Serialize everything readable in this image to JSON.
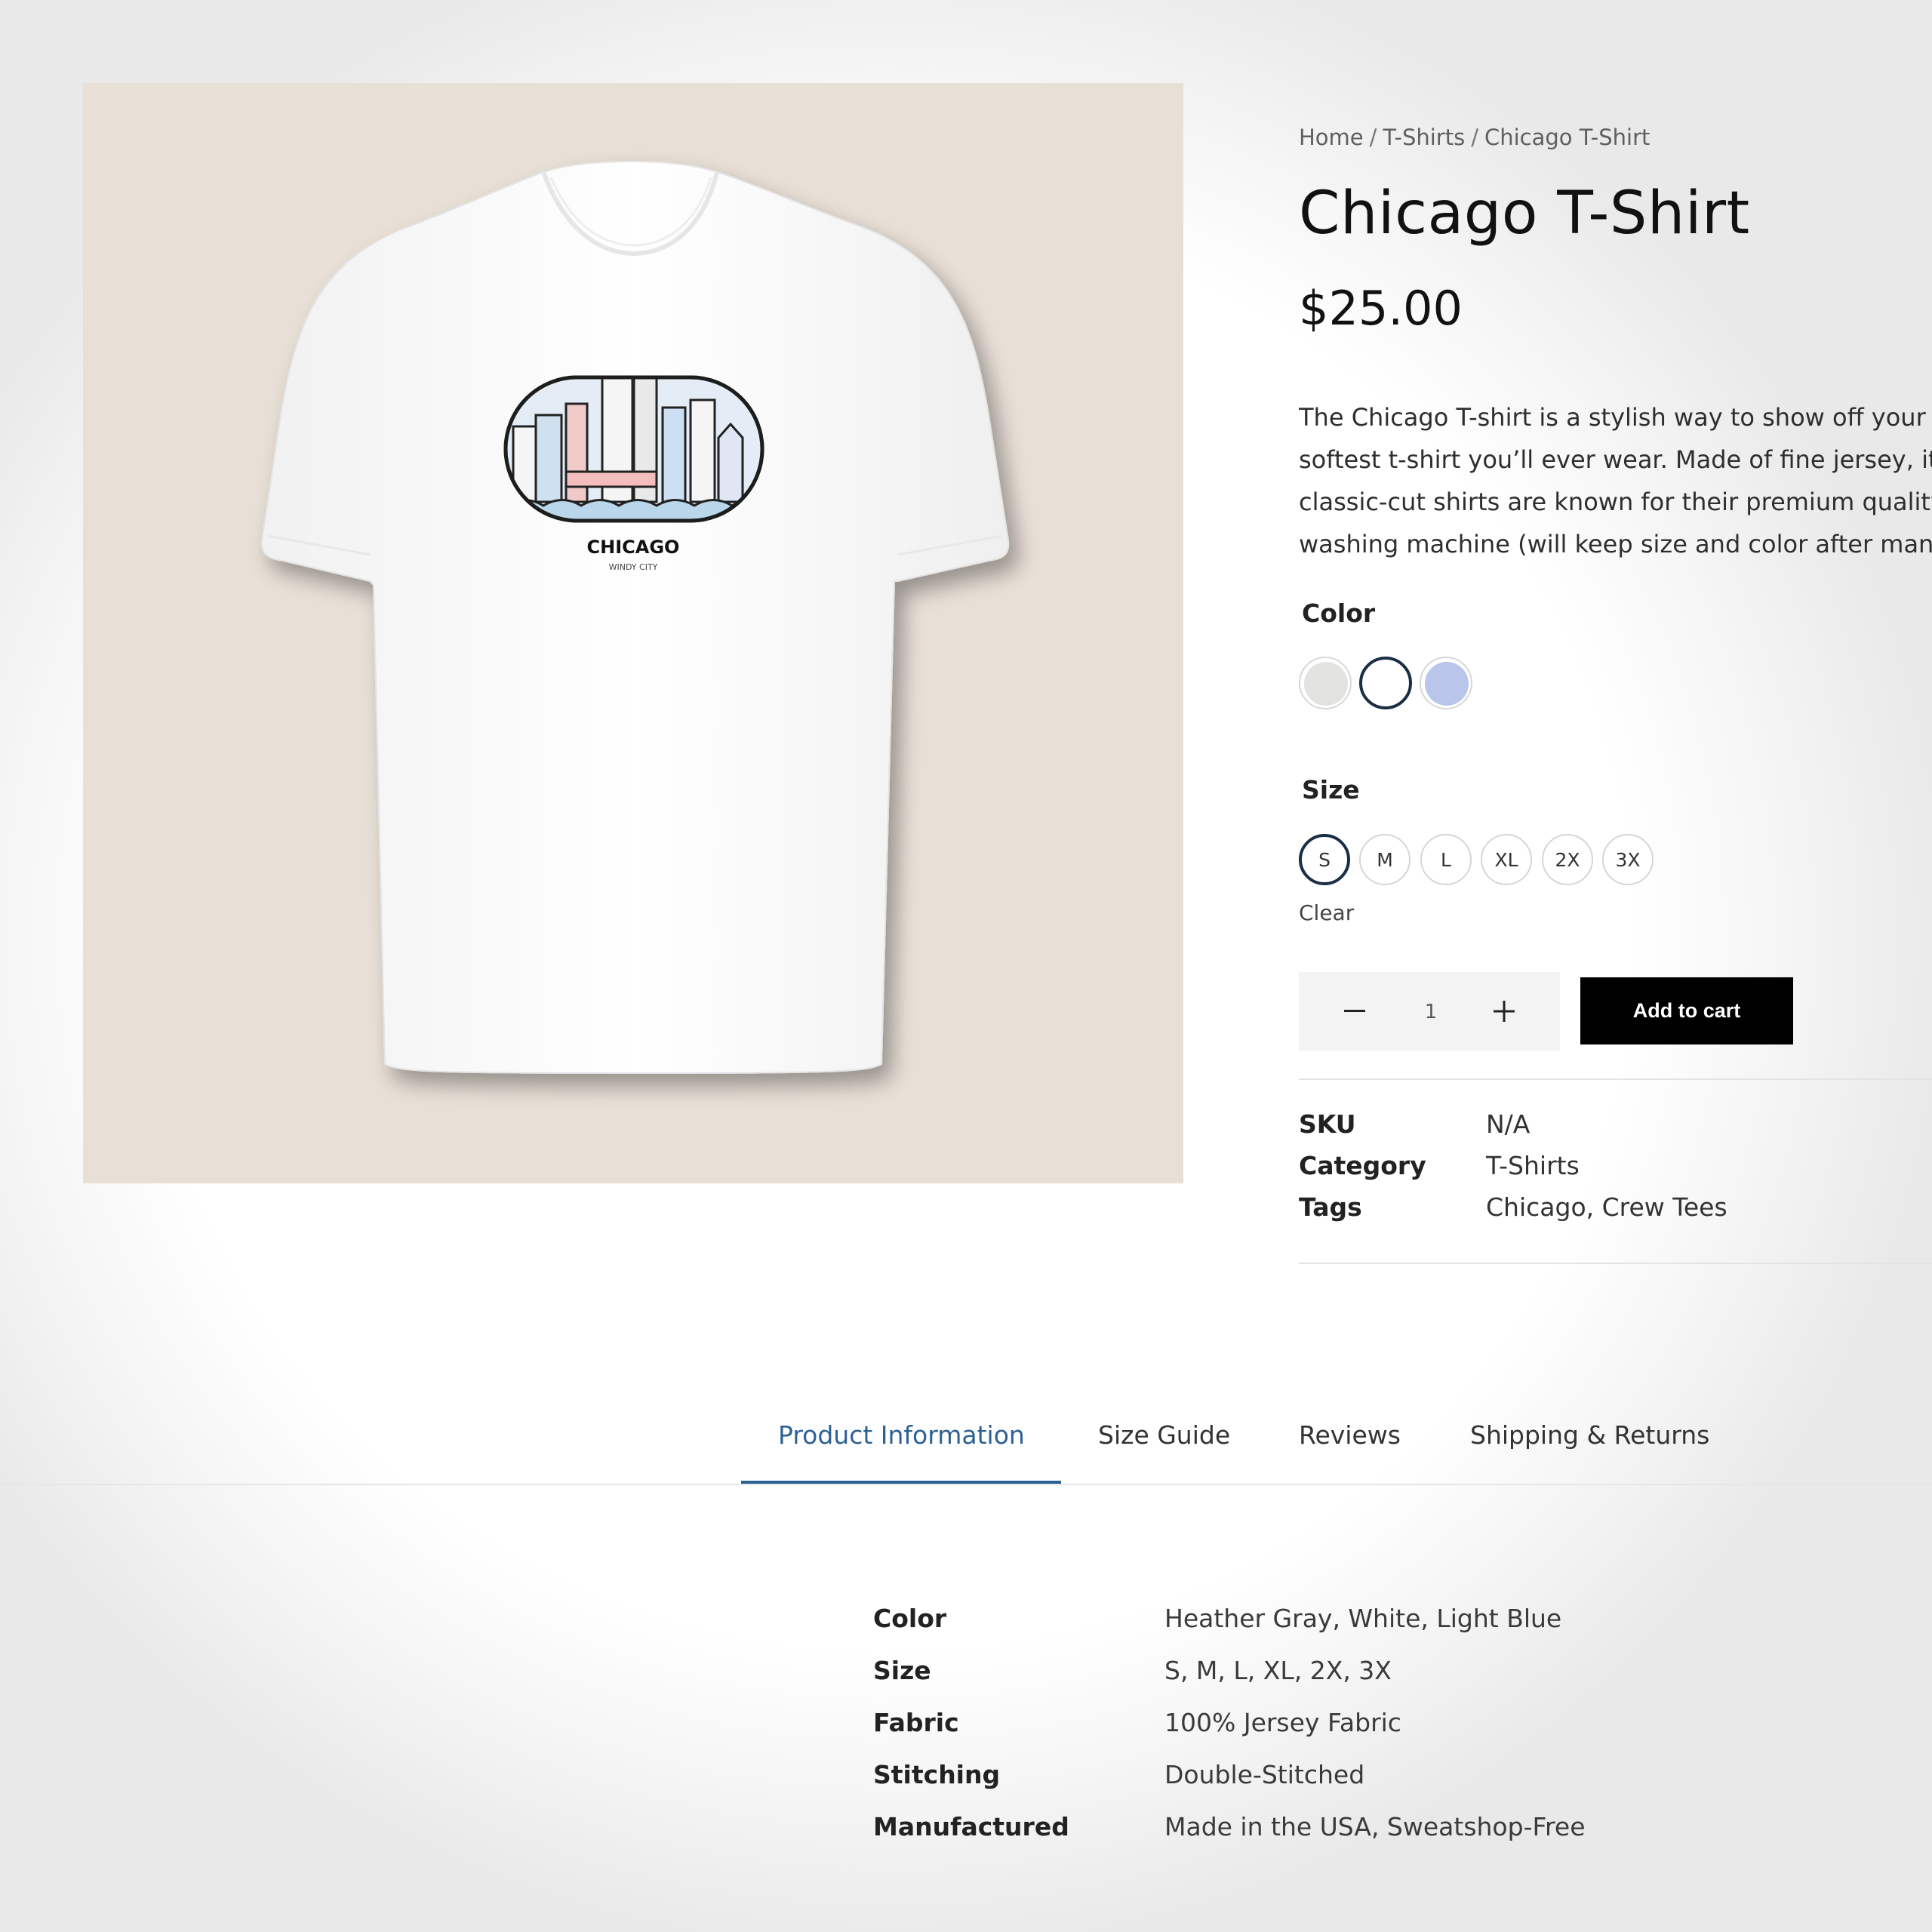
{
  "breadcrumb": {
    "home": "Home",
    "category": "T-Shirts",
    "current": "Chicago T-Shirt",
    "separator": "/"
  },
  "product": {
    "title": "Chicago T-Shirt",
    "price": "$25.00",
    "description_lines": [
      "The Chicago T-shirt is a stylish way to show off your c",
      "softest t-shirt you’ll ever wear. Made of fine jersey, it h",
      "classic-cut shirts are known for their premium quality",
      "washing machine (will keep size and color after many"
    ],
    "image": {
      "print_title": "CHICAGO",
      "print_subtitle": "WINDY CITY",
      "background_color": "#e8dfd6",
      "shirt_color": "#ffffff"
    }
  },
  "color_picker": {
    "label": "Color",
    "swatches": [
      {
        "name": "Heather Gray",
        "hex": "#e3e3e1",
        "selected": false
      },
      {
        "name": "White",
        "hex": "#ffffff",
        "selected": true
      },
      {
        "name": "Light Blue",
        "hex": "#b9c5ea",
        "selected": false
      }
    ]
  },
  "size_picker": {
    "label": "Size",
    "options": [
      "S",
      "M",
      "L",
      "XL",
      "2X",
      "3X"
    ],
    "selected": "S",
    "clear_label": "Clear"
  },
  "cart": {
    "quantity": "1",
    "minus_icon": "minus-icon",
    "plus_icon": "plus-icon",
    "add_label": "Add to cart"
  },
  "meta": {
    "sku_label": "SKU",
    "sku_value": "N/A",
    "category_label": "Category",
    "category_value": "T-Shirts",
    "tags_label": "Tags",
    "tags_value_1": "Chicago",
    "tags_value_2": "Crew Tees"
  },
  "tabs": [
    {
      "label": "Product Information",
      "active": true
    },
    {
      "label": "Size Guide",
      "active": false
    },
    {
      "label": "Reviews",
      "active": false
    },
    {
      "label": "Shipping & Returns",
      "active": false
    }
  ],
  "product_info": [
    {
      "key": "Color",
      "value": "Heather Gray, White, Light Blue"
    },
    {
      "key": "Size",
      "value": "S, M, L, XL, 2X, 3X"
    },
    {
      "key": "Fabric",
      "value": "100% Jersey Fabric"
    },
    {
      "key": "Stitching",
      "value": "Double-Stitched"
    },
    {
      "key": "Manufactured",
      "value": "Made in the USA, Sweatshop-Free"
    }
  ],
  "colors": {
    "accent": "#2d6193",
    "selected_ring": "#1a2e45",
    "button_bg": "#000000"
  }
}
